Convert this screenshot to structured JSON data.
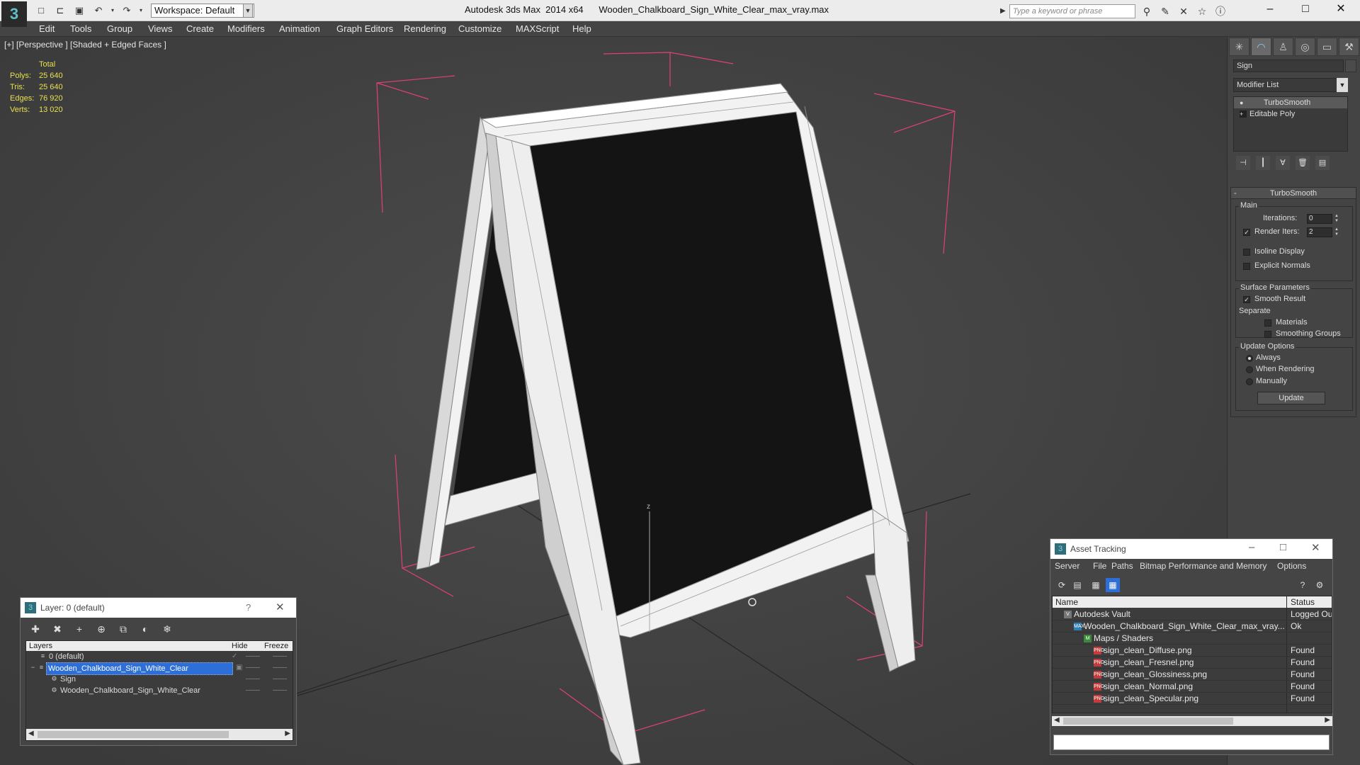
{
  "titlebar": {
    "title": "Autodesk 3ds Max  2014 x64      Wooden_Chalkboard_Sign_White_Clear_max_vray.max",
    "workspace": "Workspace: Default",
    "search_placeholder": "Type a keyword or phrase",
    "logo": "3"
  },
  "menu": [
    "Edit",
    "Tools",
    "Group",
    "Views",
    "Create",
    "Modifiers",
    "Animation",
    "Graph Editors",
    "Rendering",
    "Customize",
    "MAXScript",
    "Help"
  ],
  "viewport": {
    "label": "[+] [Perspective ] [Shaded + Edged Faces ]",
    "stats": {
      "header": "Total",
      "rows": [
        {
          "key": "Polys:",
          "value": "25 640"
        },
        {
          "key": "Tris:",
          "value": "25 640"
        },
        {
          "key": "Edges:",
          "value": "76 920"
        },
        {
          "key": "Verts:",
          "value": "13 020"
        }
      ]
    },
    "axis_label": "z",
    "colors": {
      "background": "#454545",
      "chalkboard": "#141414",
      "frame": "#f0f0f0",
      "wire": "#8a8a8a",
      "bbox": "#e0407a"
    }
  },
  "command_panel": {
    "object_name": "Sign",
    "modifier_list": "Modifier List",
    "stack": [
      "TurboSmooth",
      "Editable Poly"
    ],
    "rollout_title": "TurboSmooth",
    "main_group": "Main",
    "iterations_label": "Iterations:",
    "iterations_value": "0",
    "render_iters_label": "Render Iters:",
    "render_iters_value": "2",
    "isoline_label": "Isoline Display",
    "explicit_normals_label": "Explicit Normals",
    "surface_group": "Surface Parameters",
    "smooth_result_label": "Smooth Result",
    "separate_label": "Separate",
    "materials_label": "Materials",
    "smoothing_groups_label": "Smoothing Groups",
    "update_group": "Update Options",
    "always_label": "Always",
    "when_rendering_label": "When Rendering",
    "manually_label": "Manually",
    "update_button": "Update"
  },
  "layer_dialog": {
    "title": "Layer: 0 (default)",
    "help": "?",
    "columns": [
      "Layers",
      "Hide",
      "Freeze"
    ],
    "rows": [
      {
        "name": "0 (default)",
        "indent": 1
      },
      {
        "name": "Wooden_Chalkboard_Sign_White_Clear",
        "indent": 0,
        "selected": true
      },
      {
        "name": "Sign",
        "indent": 2
      },
      {
        "name": "Wooden_Chalkboard_Sign_White_Clear",
        "indent": 2
      }
    ]
  },
  "asset_tracking": {
    "title": "Asset Tracking",
    "menu": [
      "Server",
      "File",
      "Paths",
      "Bitmap Performance and Memory",
      "Options"
    ],
    "columns": [
      "Name",
      "Status"
    ],
    "rows": [
      {
        "name": "Autodesk Vault",
        "status": "Logged Ou",
        "icon": "vault",
        "indent": 1
      },
      {
        "name": "Wooden_Chalkboard_Sign_White_Clear_max_vray....",
        "status": "Ok",
        "icon": "max",
        "indent": 2
      },
      {
        "name": "Maps / Shaders",
        "status": "",
        "icon": "map",
        "indent": 3
      },
      {
        "name": "sign_clean_Diffuse.png",
        "status": "Found",
        "icon": "png",
        "indent": 4
      },
      {
        "name": "sign_clean_Fresnel.png",
        "status": "Found",
        "icon": "png",
        "indent": 4
      },
      {
        "name": "sign_clean_Glossiness.png",
        "status": "Found",
        "icon": "png",
        "indent": 4
      },
      {
        "name": "sign_clean_Normal.png",
        "status": "Found",
        "icon": "png",
        "indent": 4
      },
      {
        "name": "sign_clean_Specular.png",
        "status": "Found",
        "icon": "png",
        "indent": 4
      }
    ]
  }
}
